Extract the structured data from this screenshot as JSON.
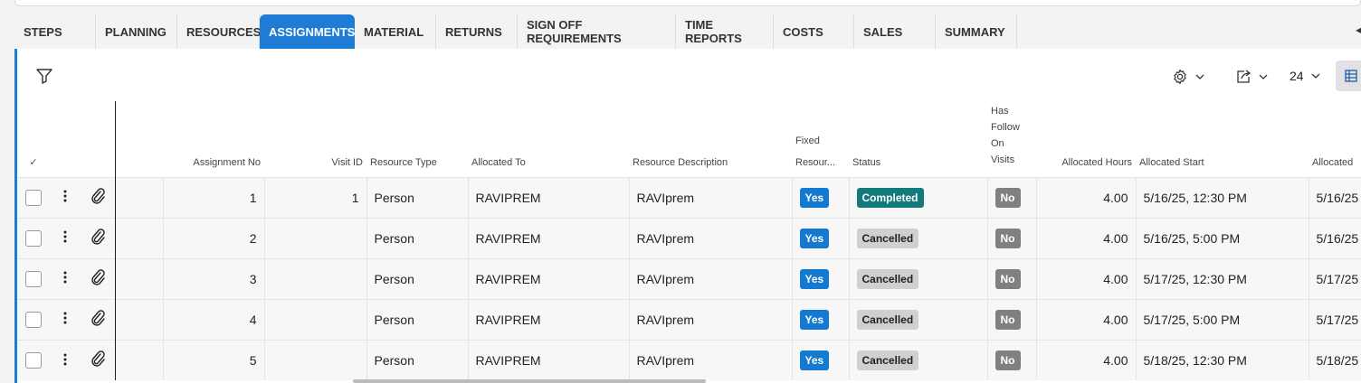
{
  "tabs": [
    {
      "label": "STEPS",
      "active": false
    },
    {
      "label": "PLANNING",
      "active": false
    },
    {
      "label": "RESOURCES",
      "active": false
    },
    {
      "label": "ASSIGNMENTS",
      "active": true
    },
    {
      "label": "MATERIAL",
      "active": false
    },
    {
      "label": "RETURNS",
      "active": false
    },
    {
      "label": "SIGN OFF REQUIREMENTS",
      "active": false
    },
    {
      "label": "TIME REPORTS",
      "active": false
    },
    {
      "label": "COSTS",
      "active": false
    },
    {
      "label": "SALES",
      "active": false
    },
    {
      "label": "SUMMARY",
      "active": false
    }
  ],
  "toolbar": {
    "filter_icon": "filter-icon",
    "settings_icon": "gear-icon",
    "export_icon": "export-icon",
    "page_size": "24",
    "view_icon": "table-view-icon"
  },
  "columns": {
    "check": "✓",
    "assignment_no": "Assignment No",
    "visit_id": "Visit ID",
    "resource_type": "Resource Type",
    "allocated_to": "Allocated To",
    "resource_description": "Resource Description",
    "fixed_resource_line1": "Fixed",
    "fixed_resource_line2": "Resour...",
    "status": "Status",
    "follow_line1": "Has",
    "follow_line2": "Follow",
    "follow_line3": "On",
    "follow_line4": "Visits",
    "allocated_hours": "Allocated Hours",
    "allocated_start": "Allocated Start",
    "allocated_end": "Allocated"
  },
  "rows": [
    {
      "assignment_no": "1",
      "visit_id": "1",
      "resource_type": "Person",
      "allocated_to": "RAVIPREM",
      "resource_description": "RAVIprem",
      "fixed": "Yes",
      "status": "Completed",
      "status_kind": "completed",
      "follow": "No",
      "hours": "4.00",
      "start": "5/16/25, 12:30 PM",
      "end": "5/16/25"
    },
    {
      "assignment_no": "2",
      "visit_id": "",
      "resource_type": "Person",
      "allocated_to": "RAVIPREM",
      "resource_description": "RAVIprem",
      "fixed": "Yes",
      "status": "Cancelled",
      "status_kind": "cancelled",
      "follow": "No",
      "hours": "4.00",
      "start": "5/16/25, 5:00 PM",
      "end": "5/16/25"
    },
    {
      "assignment_no": "3",
      "visit_id": "",
      "resource_type": "Person",
      "allocated_to": "RAVIPREM",
      "resource_description": "RAVIprem",
      "fixed": "Yes",
      "status": "Cancelled",
      "status_kind": "cancelled",
      "follow": "No",
      "hours": "4.00",
      "start": "5/17/25, 12:30 PM",
      "end": "5/17/25"
    },
    {
      "assignment_no": "4",
      "visit_id": "",
      "resource_type": "Person",
      "allocated_to": "RAVIPREM",
      "resource_description": "RAVIprem",
      "fixed": "Yes",
      "status": "Cancelled",
      "status_kind": "cancelled",
      "follow": "No",
      "hours": "4.00",
      "start": "5/17/25, 5:00 PM",
      "end": "5/17/25"
    },
    {
      "assignment_no": "5",
      "visit_id": "",
      "resource_type": "Person",
      "allocated_to": "RAVIPREM",
      "resource_description": "RAVIprem",
      "fixed": "Yes",
      "status": "Cancelled",
      "status_kind": "cancelled",
      "follow": "No",
      "hours": "4.00",
      "start": "5/18/25, 12:30 PM",
      "end": "5/18/25"
    }
  ],
  "colors": {
    "accent": "#1e7bd6",
    "completed": "#127a7a",
    "cancelled": "#d0d0d2",
    "no_badge": "#808080"
  }
}
